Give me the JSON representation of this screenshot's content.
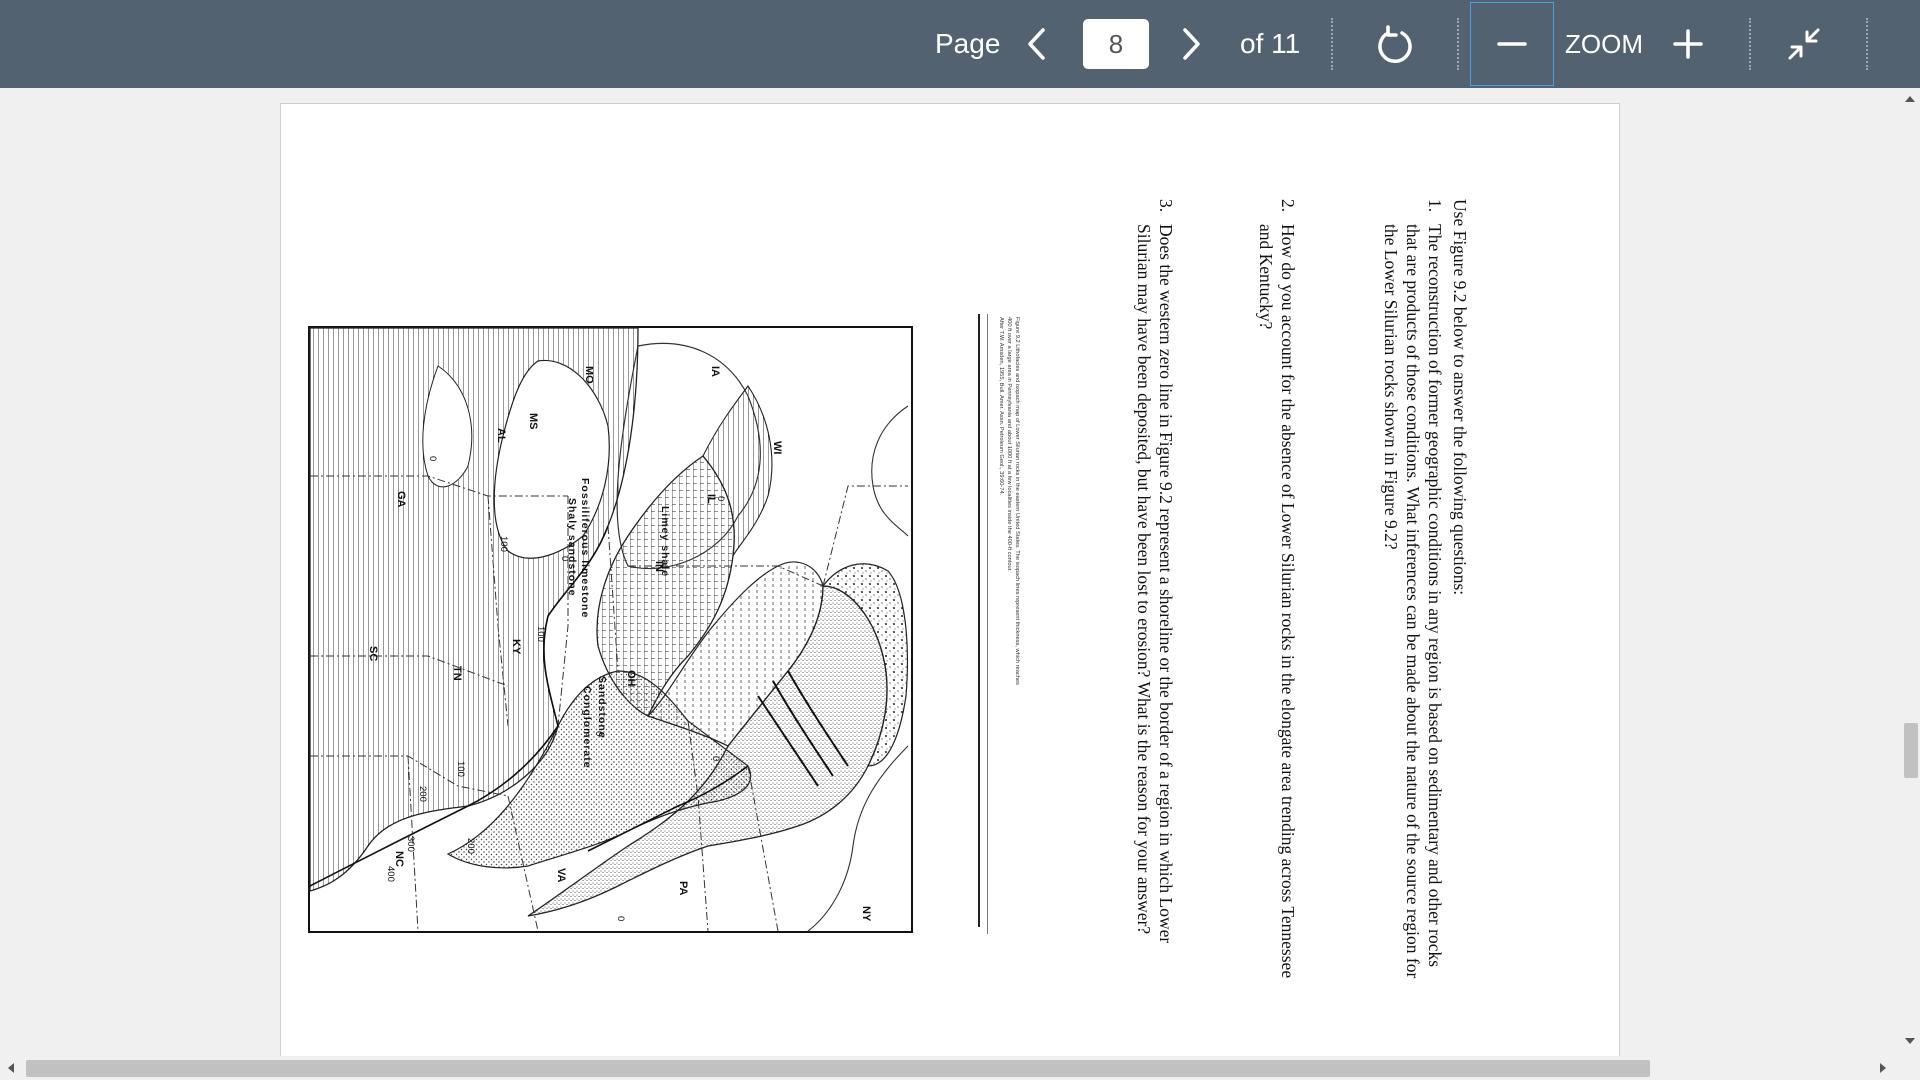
{
  "toolbar": {
    "page_label": "Page",
    "current_page": "8",
    "of_total": "of 11",
    "zoom_label": "ZOOM"
  },
  "document": {
    "intro": "Use Figure 9.2 below to answer the following questions:",
    "q1_num": "1.",
    "q1_lines": [
      "The reconstruction of former geographic conditions in any region is based on sedimentary and other rocks",
      "that are products of those conditions.  What inferences can be made about the nature of the source region for",
      "the Lower Silurian rocks shown in Figure 9.2?"
    ],
    "q2_num": "2.",
    "q2_lines": [
      "How do you account for the absence of Lower Silurian rocks in the elongate area trending across Tennessee",
      "and Kentucky?"
    ],
    "q3_num": "3.",
    "q3_lines": [
      "Does the western zero line in Figure 9.2 represent a shoreline or the border of a region in which Lower",
      "Silurian may have been deposited, but have been lost to erosion?  What is the reason for your answer?"
    ],
    "caption_lines": [
      "Figure 9.2  Lithofacies and isopach map of Lower Silurian rocks in the eastern United States. The isopach lines represent thickness, which reaches",
      "400 ft over a large area in Pennsylvania and about 1000 ft at a few localities inside the 400-ft contour.",
      "After T.W. Amsden, 1955, Bull. Amer. Assn. Petroleum Geol., 39:60-74."
    ]
  },
  "map": {
    "states": [
      "WI",
      "IA",
      "IL",
      "IN",
      "OH",
      "MO",
      "KY",
      "TN",
      "MS",
      "AL",
      "GA",
      "SC",
      "NC",
      "VA",
      "PA",
      "NY"
    ],
    "facies": [
      "Limey shale",
      "Fossiliferous limestone",
      "Shaly sandstone",
      "Sandstone",
      "Conglomerate"
    ],
    "contours": [
      "0",
      "0",
      "0",
      "0",
      "0",
      "100",
      "100",
      "100",
      "200",
      "200",
      "300",
      "400",
      "0"
    ]
  }
}
